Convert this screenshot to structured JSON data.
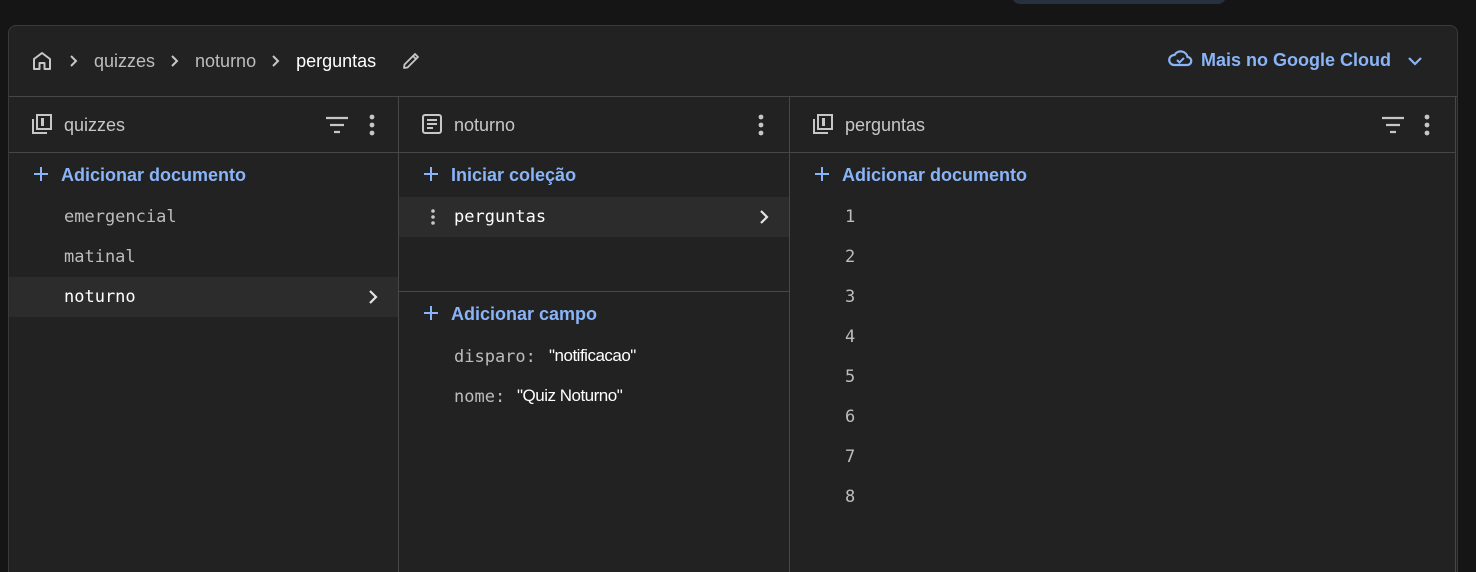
{
  "breadcrumb": {
    "items": [
      "quizzes",
      "noturno",
      "perguntas"
    ]
  },
  "header": {
    "gcloud_label": "Mais no Google Cloud"
  },
  "columns": {
    "quizzes": {
      "title": "quizzes",
      "add_label": "Adicionar documento",
      "items": [
        "emergencial",
        "matinal",
        "noturno"
      ],
      "selected": "noturno"
    },
    "noturno": {
      "title": "noturno",
      "start_collection_label": "Iniciar coleção",
      "collections": [
        "perguntas"
      ],
      "add_field_label": "Adicionar campo",
      "fields": [
        {
          "name": "disparo:",
          "value": "\"notificacao\""
        },
        {
          "name": "nome:",
          "value": "\"Quiz Noturno\""
        }
      ]
    },
    "perguntas": {
      "title": "perguntas",
      "add_label": "Adicionar documento",
      "items": [
        "1",
        "2",
        "3",
        "4",
        "5",
        "6",
        "7",
        "8"
      ]
    }
  },
  "colors": {
    "accent": "#8ab4f8",
    "background": "#222222",
    "page_background": "#151515"
  },
  "icons": [
    "home-icon",
    "chevron-right-icon",
    "pencil-icon",
    "cloud-icon",
    "chevron-down-icon",
    "collection-icon",
    "document-icon",
    "filter-icon",
    "kebab-icon",
    "plus-icon"
  ]
}
